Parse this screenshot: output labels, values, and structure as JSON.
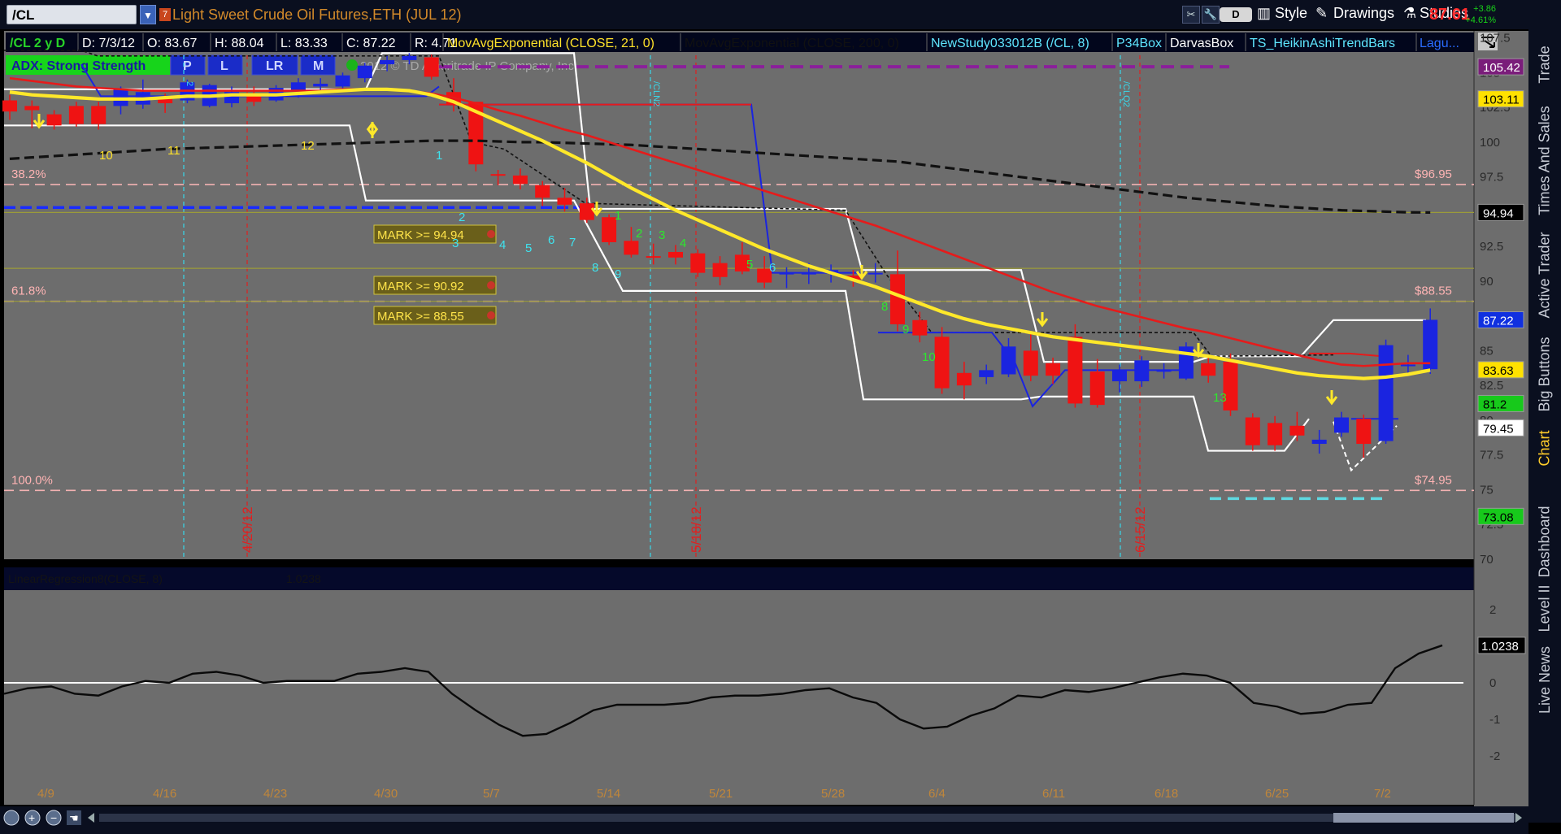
{
  "toolbar": {
    "symbol": "/CL",
    "title": "Light Sweet Crude Oil Futures,ETH (JUL 12)",
    "d_button": "D",
    "style": "Style",
    "drawings": "Drawings",
    "studies": "Studies",
    "last_price": "87.61",
    "change_abs": "+3.86",
    "change_pct": "+4.61%"
  },
  "info_bar": {
    "symbol": "/CL 2 y D",
    "date": "D: 7/3/12",
    "open": "O: 83.67",
    "high": "H: 88.04",
    "low": "L: 83.33",
    "close": "C: 87.22",
    "range": "R: 4.71",
    "study_ema": "MovAvgExponential (CLOSE, 21, 0)",
    "study_hidden": "MovAvgExponential (CLOSE, 200, 0)",
    "study_new": "NewStudy033012B (/CL, 8)",
    "study_p34": "P34Box",
    "study_darvas": "DarvasBox",
    "study_heikin": "TS_HeikinAshiTrendBars",
    "study_lag": "Lagu..."
  },
  "adx": {
    "label": "ADX:  Strong Strength",
    "buttons": [
      "P",
      "L",
      "LR",
      "M"
    ],
    "copyright": "2012 © TD Ameritrade IP Company, Inc."
  },
  "price_axis": {
    "ticks": [
      "107.5",
      "105",
      "102.5",
      "100",
      "97.5",
      "95",
      "92.5",
      "90",
      "87.5",
      "85",
      "82.5",
      "80",
      "77.5",
      "75",
      "72.5",
      "70"
    ],
    "badges": [
      {
        "value": "105.42",
        "bg": "#7a1d7a",
        "fg": "#ffffff"
      },
      {
        "value": "103.11",
        "bg": "#ffe100",
        "fg": "#000000"
      },
      {
        "value": "94.94",
        "bg": "#000000",
        "fg": "#ffffff"
      },
      {
        "value": "87.22",
        "bg": "#1030e0",
        "fg": "#ffffff"
      },
      {
        "value": "83.63",
        "bg": "#ffe100",
        "fg": "#000000"
      },
      {
        "value": "81.2",
        "bg": "#17c91b",
        "fg": "#000000"
      },
      {
        "value": "79.45",
        "bg": "#ffffff",
        "fg": "#000000"
      },
      {
        "value": "73.08",
        "bg": "#17c91b",
        "fg": "#000000"
      }
    ]
  },
  "fib": [
    {
      "pct": "38.2%",
      "price": "$96.95"
    },
    {
      "pct": "61.8%",
      "price": "$88.55"
    },
    {
      "pct": "100.0%",
      "price": "$74.95"
    }
  ],
  "marks": [
    "MARK >= 94.94",
    "MARK >= 90.92",
    "MARK >= 88.55"
  ],
  "vlines": {
    "red_dates": [
      "4/20/12",
      "5/18/12",
      "6/15/12"
    ],
    "cyan_labels": [
      "2",
      "/CLN2",
      "/CLQ2"
    ]
  },
  "counts": {
    "yellow": [
      "10",
      "11",
      "12"
    ],
    "cyan": [
      "1",
      "2",
      "3",
      "4",
      "5",
      "6",
      "7",
      "8",
      "9",
      "6"
    ],
    "green": [
      "1",
      "2",
      "3",
      "4",
      "5",
      "8",
      "9",
      "10",
      "13"
    ]
  },
  "lower_panel": {
    "title": "LinearRegression8(CLOSE, 8)",
    "title_value": "1.0238",
    "ticks": [
      "2",
      "1",
      "0",
      "-1",
      "-2"
    ],
    "badge": "1.0238"
  },
  "dates": [
    "4/9",
    "4/16",
    "4/23",
    "4/30",
    "5/7",
    "5/14",
    "5/21",
    "5/28",
    "6/4",
    "6/11",
    "6/18",
    "6/25",
    "7/2"
  ],
  "sidebar": [
    "Trade",
    "Times And Sales",
    "Active Trader",
    "Big Buttons",
    "Chart",
    "Dashboard",
    "Level II",
    "Live News"
  ],
  "colors": {
    "up": "#1a24e0",
    "down": "#ef1313",
    "ema21": "#ffe82a",
    "redma": "#e61b1b",
    "bg": "#6d6d6d"
  },
  "chart_data": {
    "type": "candlestick",
    "title": "Light Sweet Crude Oil Futures,ETH (JUL 12)",
    "ylim": [
      70,
      108
    ],
    "candles": [
      {
        "x": "4/9",
        "o": 103.0,
        "h": 103.4,
        "l": 101.6,
        "c": 102.2
      },
      {
        "x": "4/10",
        "o": 102.6,
        "h": 103.0,
        "l": 101.0,
        "c": 102.3
      },
      {
        "x": "4/11",
        "o": 102.0,
        "h": 102.3,
        "l": 100.9,
        "c": 101.2
      },
      {
        "x": "4/12",
        "o": 102.6,
        "h": 102.9,
        "l": 101.1,
        "c": 101.3
      },
      {
        "x": "4/13",
        "o": 102.6,
        "h": 102.9,
        "l": 100.9,
        "c": 101.3
      },
      {
        "x": "4/16",
        "o": 102.6,
        "h": 104.0,
        "l": 102.0,
        "c": 103.8
      },
      {
        "x": "4/17",
        "o": 102.7,
        "h": 104.5,
        "l": 102.4,
        "c": 103.6
      },
      {
        "x": "4/18",
        "o": 103.1,
        "h": 103.5,
        "l": 102.1,
        "c": 102.8
      },
      {
        "x": "4/19",
        "o": 103.0,
        "h": 104.5,
        "l": 102.8,
        "c": 104.3
      },
      {
        "x": "4/20",
        "o": 102.6,
        "h": 104.2,
        "l": 102.5,
        "c": 104.1
      },
      {
        "x": "4/23",
        "o": 102.8,
        "h": 104.0,
        "l": 102.5,
        "c": 103.6
      },
      {
        "x": "4/24",
        "o": 103.5,
        "h": 104.0,
        "l": 102.6,
        "c": 102.9
      },
      {
        "x": "4/25",
        "o": 103.0,
        "h": 104.1,
        "l": 102.9,
        "c": 103.9
      },
      {
        "x": "4/26",
        "o": 103.7,
        "h": 104.6,
        "l": 103.2,
        "c": 104.3
      },
      {
        "x": "4/27",
        "o": 104.0,
        "h": 104.6,
        "l": 103.6,
        "c": 104.2
      },
      {
        "x": "4/30",
        "o": 104.0,
        "h": 105.0,
        "l": 103.6,
        "c": 104.8
      },
      {
        "x": "5/1",
        "o": 104.6,
        "h": 105.7,
        "l": 104.3,
        "c": 105.5
      },
      {
        "x": "5/2",
        "o": 105.6,
        "h": 106.2,
        "l": 105.1,
        "c": 105.9
      },
      {
        "x": "5/3",
        "o": 105.9,
        "h": 106.4,
        "l": 105.6,
        "c": 106.2
      },
      {
        "x": "5/4",
        "o": 106.1,
        "h": 106.3,
        "l": 104.5,
        "c": 104.7
      },
      {
        "x": "5/7",
        "o": 103.6,
        "h": 104.6,
        "l": 102.2,
        "c": 102.7
      },
      {
        "x": "5/8",
        "o": 102.9,
        "h": 102.9,
        "l": 97.9,
        "c": 98.4
      },
      {
        "x": "5/9",
        "o": 97.7,
        "h": 98.0,
        "l": 96.9,
        "c": 97.6
      },
      {
        "x": "5/10",
        "o": 97.6,
        "h": 98.1,
        "l": 96.6,
        "c": 97.0
      },
      {
        "x": "5/11",
        "o": 96.9,
        "h": 97.2,
        "l": 95.4,
        "c": 96.0
      },
      {
        "x": "5/14",
        "o": 96.0,
        "h": 96.7,
        "l": 95.0,
        "c": 95.5
      },
      {
        "x": "5/15",
        "o": 95.6,
        "h": 96.0,
        "l": 94.2,
        "c": 94.4
      },
      {
        "x": "5/16",
        "o": 94.6,
        "h": 94.8,
        "l": 92.6,
        "c": 92.8
      },
      {
        "x": "5/17",
        "o": 92.9,
        "h": 93.9,
        "l": 91.7,
        "c": 91.9
      },
      {
        "x": "5/18",
        "o": 91.8,
        "h": 92.7,
        "l": 91.2,
        "c": 91.7
      },
      {
        "x": "5/21",
        "o": 92.1,
        "h": 92.6,
        "l": 91.2,
        "c": 91.7
      },
      {
        "x": "5/22",
        "o": 92.0,
        "h": 92.3,
        "l": 90.3,
        "c": 90.6
      },
      {
        "x": "5/23",
        "o": 91.3,
        "h": 91.8,
        "l": 89.7,
        "c": 90.3
      },
      {
        "x": "5/24",
        "o": 91.9,
        "h": 92.8,
        "l": 90.5,
        "c": 90.7
      },
      {
        "x": "5/25",
        "o": 90.9,
        "h": 91.8,
        "l": 89.5,
        "c": 89.9
      },
      {
        "x": "5/29",
        "o": 90.5,
        "h": 91.0,
        "l": 89.5,
        "c": 90.6
      },
      {
        "x": "5/30",
        "o": 90.5,
        "h": 91.3,
        "l": 89.8,
        "c": 90.6
      },
      {
        "x": "5/31",
        "o": 90.6,
        "h": 91.2,
        "l": 89.9,
        "c": 90.8
      },
      {
        "x": "6/1",
        "o": 90.4,
        "h": 90.8,
        "l": 89.6,
        "c": 90.1
      },
      {
        "x": "6/4",
        "o": 90.5,
        "h": 91.3,
        "l": 89.9,
        "c": 90.6
      },
      {
        "x": "6/5",
        "o": 90.5,
        "h": 92.2,
        "l": 86.4,
        "c": 86.9
      },
      {
        "x": "6/6",
        "o": 87.2,
        "h": 87.8,
        "l": 85.6,
        "c": 86.1
      },
      {
        "x": "6/7",
        "o": 86.0,
        "h": 86.7,
        "l": 81.9,
        "c": 82.3
      },
      {
        "x": "6/8",
        "o": 83.4,
        "h": 84.2,
        "l": 81.5,
        "c": 82.5
      },
      {
        "x": "6/11",
        "o": 83.1,
        "h": 84.0,
        "l": 82.6,
        "c": 83.6
      },
      {
        "x": "6/12",
        "o": 83.3,
        "h": 85.9,
        "l": 83.1,
        "c": 85.3
      },
      {
        "x": "6/13",
        "o": 85.0,
        "h": 86.3,
        "l": 82.8,
        "c": 83.2
      },
      {
        "x": "6/14",
        "o": 84.1,
        "h": 84.5,
        "l": 82.6,
        "c": 83.2
      },
      {
        "x": "6/15",
        "o": 86.0,
        "h": 86.9,
        "l": 80.9,
        "c": 81.2
      },
      {
        "x": "6/18",
        "o": 83.5,
        "h": 84.4,
        "l": 80.9,
        "c": 81.1
      },
      {
        "x": "6/19",
        "o": 82.8,
        "h": 84.0,
        "l": 82.0,
        "c": 83.6
      },
      {
        "x": "6/20",
        "o": 82.8,
        "h": 84.6,
        "l": 82.4,
        "c": 84.3
      },
      {
        "x": "6/21",
        "o": 83.5,
        "h": 84.1,
        "l": 83.0,
        "c": 83.6
      },
      {
        "x": "6/22",
        "o": 83.0,
        "h": 85.6,
        "l": 82.9,
        "c": 85.3
      },
      {
        "x": "6/25",
        "o": 84.1,
        "h": 84.6,
        "l": 82.7,
        "c": 83.2
      },
      {
        "x": "6/26",
        "o": 84.2,
        "h": 84.8,
        "l": 80.3,
        "c": 80.7
      },
      {
        "x": "6/27",
        "o": 80.2,
        "h": 80.5,
        "l": 77.8,
        "c": 78.2
      },
      {
        "x": "6/28",
        "o": 79.8,
        "h": 80.3,
        "l": 77.8,
        "c": 78.2
      },
      {
        "x": "6/29",
        "o": 79.6,
        "h": 80.6,
        "l": 78.5,
        "c": 78.9
      },
      {
        "x": "7/2",
        "o": 78.3,
        "h": 79.3,
        "l": 77.6,
        "c": 78.6
      },
      {
        "x": "7/3a",
        "o": 79.1,
        "h": 80.6,
        "l": 78.8,
        "c": 80.2
      },
      {
        "x": "7/3b",
        "o": 80.1,
        "h": 80.4,
        "l": 77.3,
        "c": 78.3
      },
      {
        "x": "7/3c",
        "o": 78.5,
        "h": 85.8,
        "l": 78.3,
        "c": 85.4
      },
      {
        "x": "7/3d",
        "o": 84.0,
        "h": 84.7,
        "l": 83.3,
        "c": 84.0
      },
      {
        "x": "7/3",
        "o": 83.67,
        "h": 88.04,
        "l": 83.33,
        "c": 87.22
      }
    ],
    "ema21": [
      103.6,
      103.4,
      103.3,
      103.2,
      103.1,
      103.1,
      103.1,
      103.2,
      103.3,
      103.3,
      103.4,
      103.4,
      103.4,
      103.5,
      103.6,
      103.7,
      103.8,
      103.8,
      103.7,
      103.4,
      102.9,
      102.2,
      101.5,
      100.8,
      100.1,
      99.3,
      98.5,
      97.6,
      96.7,
      95.9,
      95.1,
      94.4,
      93.7,
      93.0,
      92.3,
      91.7,
      91.1,
      90.6,
      90.1,
      89.6,
      89.0,
      88.4,
      87.8,
      87.3,
      86.9,
      86.6,
      86.3,
      86.0,
      85.8,
      85.6,
      85.4,
      85.2,
      85.0,
      84.8,
      84.6,
      84.3,
      84.0,
      83.7,
      83.4,
      83.2,
      83.1,
      83.0,
      83.1,
      83.3,
      83.6
    ],
    "red_ma": [
      104.6,
      104.4,
      104.2,
      104.0,
      103.9,
      103.8,
      103.7,
      103.7,
      103.7,
      103.7,
      103.7,
      103.7,
      103.7,
      103.7,
      103.7,
      103.8,
      103.8,
      103.8,
      103.7,
      103.5,
      103.2,
      102.8,
      102.3,
      101.9,
      101.4,
      100.9,
      100.5,
      100.0,
      99.5,
      99.0,
      98.5,
      98.0,
      97.5,
      97.0,
      96.5,
      96.0,
      95.5,
      95.0,
      94.5,
      94.0,
      93.4,
      92.8,
      92.2,
      91.6,
      91.0,
      90.4,
      89.8,
      89.2,
      88.7,
      88.2,
      87.8,
      87.4,
      87.0,
      86.6,
      86.3,
      85.9,
      85.5,
      85.1,
      84.7,
      84.3,
      84.0,
      83.9,
      84.0,
      84.1,
      84.1
    ],
    "ma200": [
      98.8,
      98.9,
      99.0,
      99.1,
      99.2,
      99.3,
      99.4,
      99.5,
      99.55,
      99.6,
      99.65,
      99.7,
      99.75,
      99.8,
      99.85,
      99.9,
      99.95,
      100.0,
      100.05,
      100.1,
      100.1,
      100.1,
      100.05,
      100.0,
      100.0,
      99.95,
      99.9,
      99.85,
      99.8,
      99.7,
      99.6,
      99.5,
      99.4,
      99.3,
      99.2,
      99.1,
      99.0,
      98.9,
      98.8,
      98.7,
      98.6,
      98.4,
      98.2,
      98.0,
      97.8,
      97.6,
      97.4,
      97.2,
      97.0,
      96.8,
      96.6,
      96.4,
      96.2,
      96.0,
      95.85,
      95.7,
      95.55,
      95.4,
      95.3,
      95.2,
      95.1,
      95.05,
      95.0,
      94.95,
      94.94
    ],
    "linreg": [
      -0.3,
      -0.15,
      -0.1,
      -0.3,
      -0.35,
      -0.1,
      0.05,
      0.0,
      0.25,
      0.3,
      0.2,
      0.0,
      0.05,
      0.05,
      0.05,
      0.25,
      0.3,
      0.4,
      0.3,
      -0.3,
      -0.75,
      -1.15,
      -1.45,
      -1.4,
      -1.1,
      -0.75,
      -0.6,
      -0.6,
      -0.6,
      -0.55,
      -0.4,
      -0.35,
      -0.35,
      -0.3,
      -0.2,
      -0.15,
      -0.4,
      -0.55,
      -1.0,
      -1.25,
      -1.2,
      -0.9,
      -0.7,
      -0.35,
      -0.4,
      -0.2,
      -0.25,
      -0.15,
      0.0,
      0.15,
      0.25,
      0.2,
      0.0,
      -0.55,
      -0.65,
      -0.85,
      -0.8,
      -0.6,
      -0.55,
      0.4,
      0.8,
      1.0238
    ],
    "fib_levels": [
      96.95,
      88.55,
      74.95
    ],
    "marks_levels": [
      94.94,
      90.92,
      88.55
    ]
  }
}
